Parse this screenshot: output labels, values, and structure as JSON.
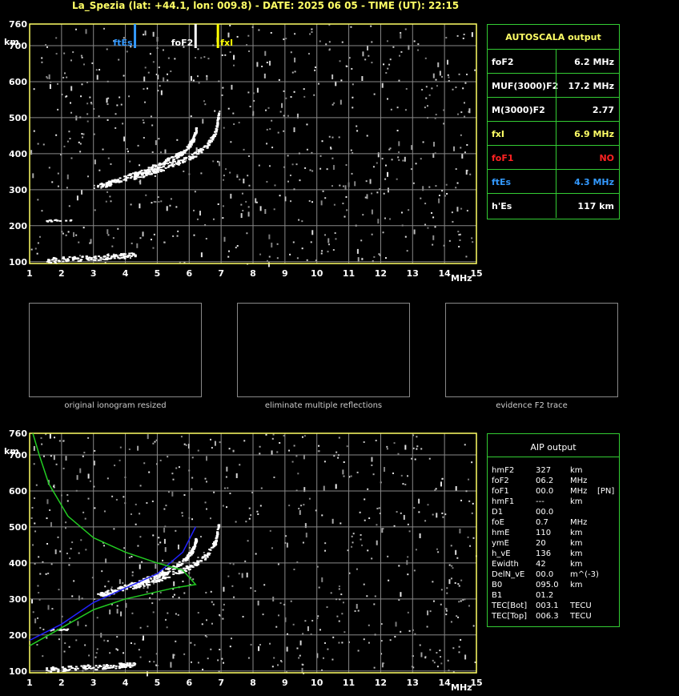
{
  "title": "La_Spezia (lat: +44.1, lon: 009.8) - DATE: 2025 06 05 - TIME (UT): 22:15",
  "colors": {
    "axis": "#ffff66",
    "grid": "#888888",
    "trace": "#ffffff",
    "fEs": "#3399ff",
    "foF2": "#ffffff",
    "fxI": "#ffff00",
    "profile": "#2222ff",
    "model": "#22cc22",
    "panel_border": "#33cc33"
  },
  "autoscala": {
    "header": "AUTOSCALA output",
    "rows": [
      {
        "label": "foF2",
        "value": "6.2 MHz",
        "color": "#ffffff"
      },
      {
        "label": "MUF(3000)F2",
        "value": "17.2 MHz",
        "color": "#ffffff"
      },
      {
        "label": "M(3000)F2",
        "value": "2.77",
        "color": "#ffffff"
      },
      {
        "label": "fxI",
        "value": "6.9 MHz",
        "color": "#ffff66"
      },
      {
        "label": "foF1",
        "value": "NO",
        "color": "#ff2222"
      },
      {
        "label": "ftEs",
        "value": "4.3 MHz",
        "color": "#3399ff"
      },
      {
        "label": "h'Es",
        "value": "117     km",
        "color": "#ffffff"
      }
    ]
  },
  "aip": {
    "header": "AIP output",
    "rows": [
      [
        "hmF2",
        "327",
        "km",
        ""
      ],
      [
        "foF2",
        "06.2",
        "MHz",
        ""
      ],
      [
        "foF1",
        "00.0",
        "MHz",
        "[PN]"
      ],
      [
        "hmF1",
        "---",
        "km",
        ""
      ],
      [
        "D1",
        "00.0",
        "",
        ""
      ],
      [
        "foE",
        "0.7",
        "MHz",
        ""
      ],
      [
        "hmE",
        "110",
        "km",
        ""
      ],
      [
        "ymE",
        "20",
        "km",
        ""
      ],
      [
        "h_vE",
        "136",
        "km",
        ""
      ],
      [
        "Ewidth",
        "42",
        "km",
        ""
      ],
      [
        "DelN_vE",
        "00.0",
        "m^(-3)",
        ""
      ],
      [
        "B0",
        "095.0",
        "km",
        ""
      ],
      [
        "B1",
        "01.2",
        "",
        ""
      ],
      [
        "TEC[Bot]",
        "003.1",
        "TECU",
        ""
      ],
      [
        "TEC[Top]",
        "006.3",
        "TECU",
        ""
      ]
    ]
  },
  "thumbnails": [
    {
      "caption": "original ionogram resized"
    },
    {
      "caption": "eliminate multiple reflections"
    },
    {
      "caption": "evidence F2 trace"
    }
  ],
  "chart_data": [
    {
      "type": "scatter",
      "title": "",
      "xlabel": "MHz",
      "ylabel": "km",
      "xlim": [
        1,
        15
      ],
      "ylim": [
        95,
        760
      ],
      "x_ticks": [
        "1",
        "2",
        "3",
        "4",
        "5",
        "6",
        "7",
        "8",
        "9",
        "10",
        "11",
        "12",
        "13",
        "14",
        "15"
      ],
      "y_ticks": [
        "100",
        "200",
        "300",
        "400",
        "500",
        "600",
        "700",
        "760"
      ],
      "markers": [
        {
          "name": "ftEs",
          "x": 4.3,
          "color": "#3399ff"
        },
        {
          "name": "foF2",
          "x": 6.2,
          "color": "#ffffff"
        },
        {
          "name": "fxI",
          "x": 6.9,
          "color": "#ffff00"
        }
      ],
      "traces": {
        "F2_o": [
          [
            3.1,
            310
          ],
          [
            3.5,
            320
          ],
          [
            4.0,
            335
          ],
          [
            4.5,
            350
          ],
          [
            5.0,
            370
          ],
          [
            5.5,
            390
          ],
          [
            5.9,
            415
          ],
          [
            6.1,
            440
          ],
          [
            6.2,
            470
          ]
        ],
        "F2_x": [
          [
            4.2,
            335
          ],
          [
            4.8,
            350
          ],
          [
            5.4,
            370
          ],
          [
            6.0,
            390
          ],
          [
            6.5,
            420
          ],
          [
            6.8,
            460
          ],
          [
            6.9,
            510
          ]
        ],
        "Es": [
          [
            1.5,
            105
          ],
          [
            2.5,
            110
          ],
          [
            3.5,
            115
          ],
          [
            4.3,
            120
          ]
        ],
        "Es2": [
          [
            1.5,
            215
          ],
          [
            2.3,
            218
          ]
        ]
      }
    },
    {
      "type": "line",
      "title": "",
      "xlabel": "MHz",
      "ylabel": "km",
      "xlim": [
        1,
        15
      ],
      "ylim": [
        95,
        760
      ],
      "x_ticks": [
        "1",
        "2",
        "3",
        "4",
        "5",
        "6",
        "7",
        "8",
        "9",
        "10",
        "11",
        "12",
        "13",
        "14",
        "15"
      ],
      "y_ticks": [
        "100",
        "200",
        "300",
        "400",
        "500",
        "600",
        "700",
        "760"
      ],
      "series": [
        {
          "color": "#2222ff",
          "points": [
            [
              1,
              185
            ],
            [
              2,
              230
            ],
            [
              3,
              290
            ],
            [
              4,
              330
            ],
            [
              5,
              370
            ],
            [
              5.8,
              430
            ],
            [
              6.2,
              500
            ]
          ]
        },
        {
          "color": "#22cc22",
          "points": [
            [
              1.1,
              760
            ],
            [
              1.3,
              700
            ],
            [
              1.6,
              620
            ],
            [
              2.2,
              530
            ],
            [
              3.0,
              470
            ],
            [
              4.0,
              430
            ],
            [
              5.0,
              400
            ],
            [
              5.8,
              380
            ],
            [
              6.2,
              340
            ],
            [
              5.5,
              330
            ],
            [
              4.0,
              300
            ],
            [
              3.0,
              270
            ],
            [
              2.0,
              220
            ],
            [
              1.0,
              170
            ]
          ]
        }
      ]
    }
  ]
}
